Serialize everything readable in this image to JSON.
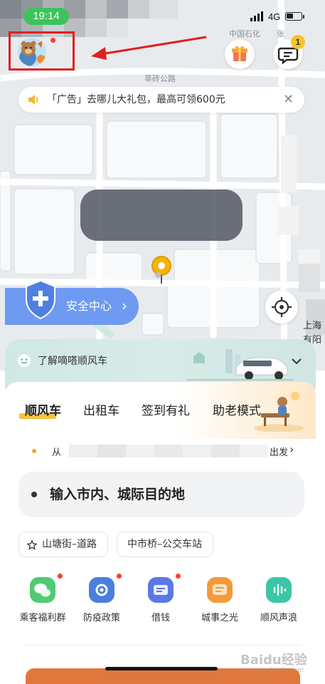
{
  "status_bar": {
    "time": "19:14",
    "network": "4G",
    "accent": "#3cc45a"
  },
  "map": {
    "labels": {
      "road": "莘砖公路",
      "poi": "中国石化",
      "poi2": "张",
      "right_edge_1": "上海",
      "right_edge_2": "有阳"
    },
    "ad": {
      "text": "「广告」去哪儿大礼包，最高可领600元",
      "close": "✕"
    },
    "safety_center": {
      "label": "安全中心",
      "chevron": "›",
      "color": "#6f9af1"
    },
    "message_badge": "1"
  },
  "sheet": {
    "learn_text": "了解嘀嗒顺风车",
    "tabs": [
      {
        "label": "顺风车",
        "active": true
      },
      {
        "label": "出租车",
        "active": false
      },
      {
        "label": "签到有礼",
        "active": false
      },
      {
        "label": "助老模式",
        "active": false
      }
    ],
    "recent": {
      "start_fragment": "从",
      "end_fragment": "出发",
      "chevron": "›"
    },
    "destination_placeholder": "输入市内、城际目的地",
    "quick_places": [
      {
        "label": "山塘街–道路",
        "icon": "star-outline-icon"
      },
      {
        "label": "中市桥–公交车站"
      }
    ],
    "services": [
      {
        "label": "乘客福利群",
        "icon": "wechat-group-icon",
        "color": "#4fcb73",
        "dot": true
      },
      {
        "label": "防疫政策",
        "icon": "shield-settings-icon",
        "color": "#4a7fe0",
        "dot": true
      },
      {
        "label": "借钱",
        "icon": "wallet-card-icon",
        "color": "#5a78e6",
        "dot": true
      },
      {
        "label": "城事之光",
        "icon": "chat-bubble-icon",
        "color": "#f39a3c",
        "dot": false
      },
      {
        "label": "顺风声浪",
        "icon": "sound-wave-icon",
        "color": "#3bc6a6",
        "dot": false
      }
    ]
  },
  "watermark": {
    "main": "Baidu经验",
    "sub": "jingyan.baidu.com"
  }
}
